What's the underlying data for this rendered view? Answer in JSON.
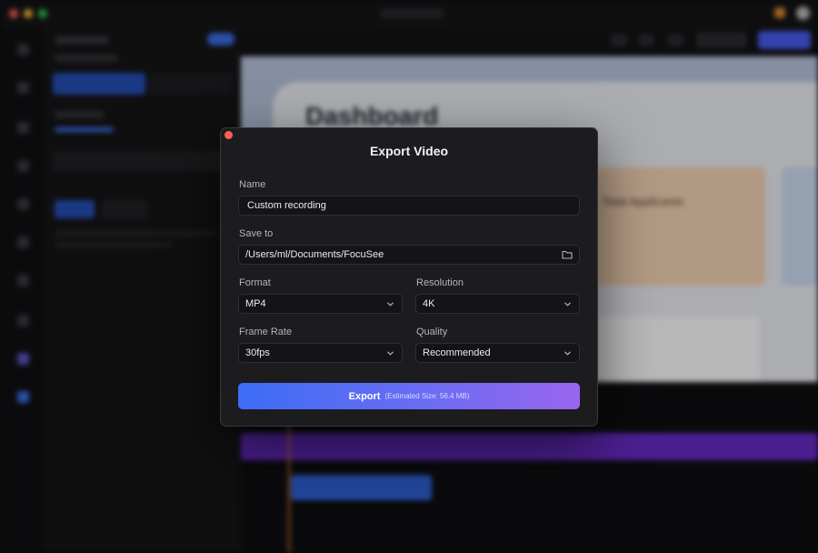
{
  "dialog": {
    "title": "Export Video",
    "name_label": "Name",
    "name_value": "Custom recording",
    "save_label": "Save to",
    "save_path": "/Users/ml/Documents/FocuSee",
    "format_label": "Format",
    "format_value": "MP4",
    "resolution_label": "Resolution",
    "resolution_value": "4K",
    "framerate_label": "Frame Rate",
    "framerate_value": "30fps",
    "quality_label": "Quality",
    "quality_value": "Recommended",
    "export_label": "Export",
    "estimated_size": "(Estimated Size: 56.4 MB)"
  },
  "background": {
    "preview_heading": "Dashboard",
    "card_text": "Total Applicants"
  },
  "colors": {
    "dialog_bg": "#1c1c1f",
    "accent_start": "#3d6cf5",
    "accent_end": "#9a65ee",
    "close": "#ff5f57"
  },
  "icons": [
    "close-icon",
    "folder-icon",
    "chevron-down-icon"
  ]
}
